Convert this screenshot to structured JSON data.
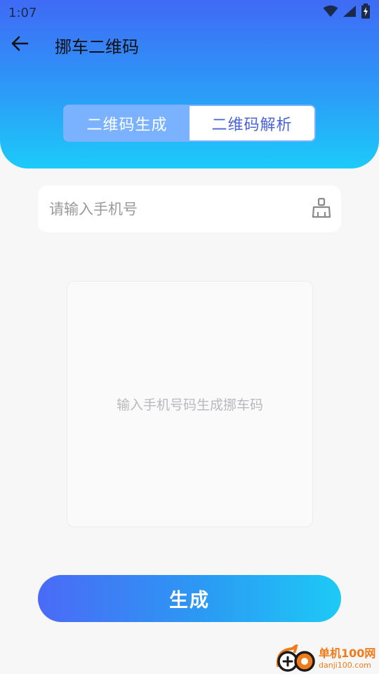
{
  "status_bar": {
    "time": "1:07",
    "icons": [
      "wifi-icon",
      "signal-icon",
      "battery-charging-icon"
    ]
  },
  "toolbar": {
    "back_icon": "arrow-left-icon",
    "title": "挪车二维码"
  },
  "tabs": [
    {
      "label": "二维码生成",
      "active": true
    },
    {
      "label": "二维码解析",
      "active": false
    }
  ],
  "phone_input": {
    "value": "",
    "placeholder": "请输入手机号",
    "clear_icon": "broom-icon"
  },
  "qr_preview": {
    "hint": "输入手机号码生成挪车码"
  },
  "generate_button": {
    "label": "生成"
  },
  "watermark": {
    "name": "单机100网",
    "domain": "danji100.com"
  },
  "colors": {
    "header_top": "#3f6af5",
    "header_bottom": "#1ccbf9",
    "tab_active": "#7ab2ff",
    "tab_inactive_text": "#4a64d6",
    "button_start": "#4a6af6",
    "button_end": "#1dcaf6",
    "watermark": "#f07b18"
  }
}
